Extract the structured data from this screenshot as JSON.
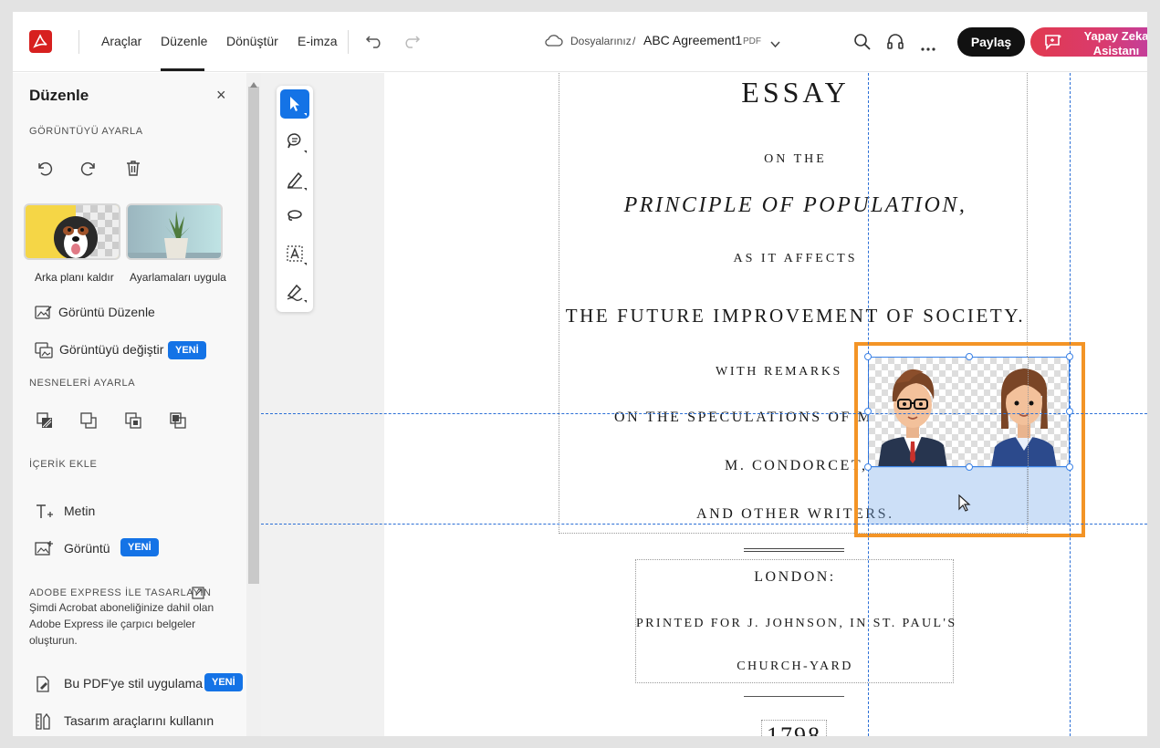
{
  "topbar": {
    "menu": [
      "Araçlar",
      "Düzenle",
      "Dönüştür",
      "E-imza"
    ],
    "breadcrumb_root": "Dosyalarınız",
    "breadcrumb_sep": "/",
    "doc_title": "ABC Agreement1",
    "doc_type": "PDF",
    "share_label": "Paylaş",
    "ai_label": "Yapay Zeka Asistanı"
  },
  "panel": {
    "title": "Düzenle",
    "close": "×",
    "section_adjust_image": "GÖRÜNTÜYÜ AYARLA",
    "thumb1_label": "Arka planı kaldır",
    "thumb2_label": "Ayarlamaları uygula",
    "edit_image": "Görüntü Düzenle",
    "replace_image": "Görüntüyü değiştir",
    "new_badge": "YENİ",
    "section_objects": "NESNELERİ AYARLA",
    "section_add": "İÇERİK EKLE",
    "add_text": "Metin",
    "add_image": "Görüntü",
    "section_express": "ADOBE EXPRESS İLE TASARLAYIN",
    "express_text": "Şimdi Acrobat aboneliğinize dahil olan Adobe Express ile çarpıcı belgeler oluşturun.",
    "apply_style": "Bu PDF'ye stil uygulama",
    "design_tools": "Tasarım araçlarını kullanın"
  },
  "document": {
    "line1": "ESSAY",
    "line2": "ON THE",
    "line3": "PRINCIPLE OF POPULATION,",
    "line4": "AS IT AFFECTS",
    "line5": "THE FUTURE IMPROVEMENT OF SOCIETY.",
    "line6": "WITH REMARKS",
    "line7": "ON THE SPECULATIONS OF M",
    "line8": "M. CONDORCET,",
    "line9": "AND OTHER WRITERS.",
    "line10": "LONDON:",
    "line11": "PRINTED FOR J. JOHNSON, IN ST. PAUL'S",
    "line12": "CHURCH-YARD",
    "line13": "1798"
  },
  "colors": {
    "acrobat_red": "#d7201f",
    "accent_blue": "#1473e6",
    "selection_orange": "#f39426"
  }
}
